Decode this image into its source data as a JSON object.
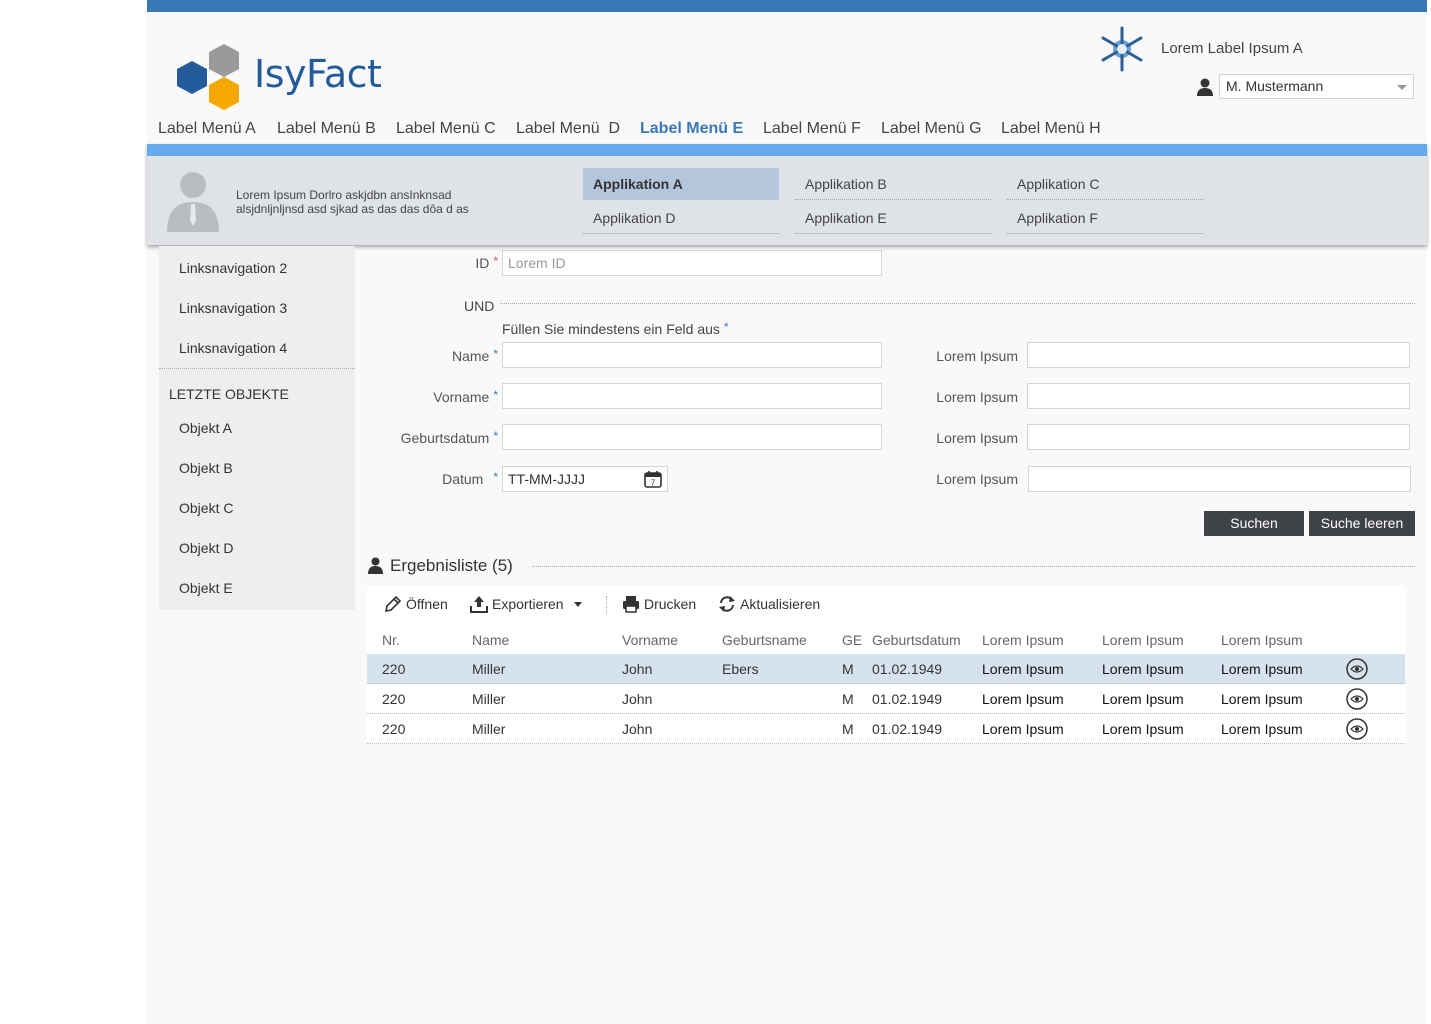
{
  "header": {
    "logo_text": "IsyFact",
    "app_label": "Lorem Label Ipsum A",
    "user": "M. Mustermann"
  },
  "main_nav": [
    "Label Menü A",
    "Label Menü B",
    "Label Menü C",
    "Label Menü  D",
    "Label Menü E",
    "Label Menü F",
    "Label Menü G",
    "Label Menü H"
  ],
  "main_nav_active": "Label Menü E",
  "mega_menu": {
    "description_line1": "Lorem Ipsum Dorlro askjdbn ansInknsad",
    "description_line2": "alsjdnljnljnsd asd sjkad as das das dôa d as",
    "apps": [
      "Applikation A",
      "Applikation B",
      "Applikation C",
      "Applikation D",
      "Applikation E",
      "Applikation F"
    ],
    "active_app": "Applikation A"
  },
  "sidebar": {
    "links": [
      "Linksnavigation 2",
      "Linksnavigation 3",
      "Linksnavigation 4"
    ],
    "recent_heading": "LETZTE OBJEKTE",
    "recent": [
      "Objekt A",
      "Objekt B",
      "Objekt C",
      "Objekt D",
      "Objekt E"
    ]
  },
  "form": {
    "id_label": "ID",
    "id_placeholder": "Lorem ID",
    "und": "UND",
    "hint": "Füllen Sie mindestens ein Feld aus",
    "name_label": "Name",
    "vorname_label": "Vorname",
    "geburtsdatum_label": "Geburtsdatum",
    "datum_label": "Datum",
    "datum_value": "TT-MM-JJJJ",
    "right_labels": [
      "Lorem Ipsum",
      "Lorem Ipsum",
      "Lorem Ipsum",
      "Lorem Ipsum"
    ],
    "search_button": "Suchen",
    "clear_button": "Suche leeren"
  },
  "results": {
    "title": "Ergebnisliste (5)",
    "toolbar": {
      "open": "Öffnen",
      "export": "Exportieren",
      "print": "Drucken",
      "refresh": "Aktualisieren"
    },
    "columns": [
      "Nr.",
      "Name",
      "Vorname",
      "Geburtsname",
      "GE",
      "Geburtsdatum",
      "Lorem Ipsum",
      "Lorem Ipsum",
      "Lorem Ipsum"
    ],
    "rows": [
      {
        "nr": "220",
        "name": "Miller",
        "vorname": "John",
        "geburtsname": "Ebers",
        "ge": "M",
        "geburtsdatum": "01.02.1949",
        "c1": "Lorem Ipsum",
        "c2": "Lorem Ipsum",
        "c3": "Lorem Ipsum"
      },
      {
        "nr": "220",
        "name": "Miller",
        "vorname": "John",
        "geburtsname": "",
        "ge": "M",
        "geburtsdatum": "01.02.1949",
        "c1": "Lorem Ipsum",
        "c2": "Lorem Ipsum",
        "c3": "Lorem Ipsum"
      },
      {
        "nr": "220",
        "name": "Miller",
        "vorname": "John",
        "geburtsname": "",
        "ge": "M",
        "geburtsdatum": "01.02.1949",
        "c1": "Lorem Ipsum",
        "c2": "Lorem Ipsum",
        "c3": "Lorem Ipsum"
      }
    ],
    "selected_row": 0
  },
  "colors": {
    "accent": "#3a78b5",
    "mega_bar": "#66aaee",
    "button": "#3f4247",
    "selected_row": "#d6e3ee",
    "logo_blue": "#235a9a",
    "logo_orange": "#f5a800",
    "logo_grey": "#9a9a9a"
  }
}
